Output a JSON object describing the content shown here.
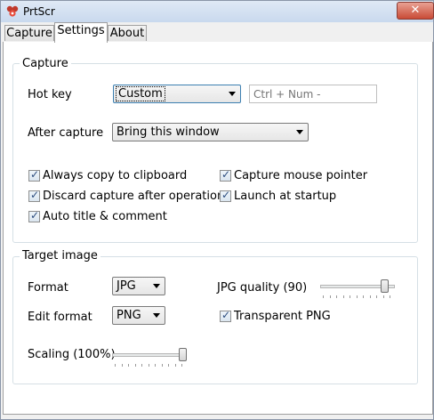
{
  "window": {
    "title": "PrtScr",
    "close_label": "✕"
  },
  "tabs": [
    {
      "label": "Capture",
      "active": false
    },
    {
      "label": "Settings",
      "active": true
    },
    {
      "label": "About",
      "active": false
    }
  ],
  "capture_group": {
    "title": "Capture",
    "hotkey_label": "Hot key",
    "hotkey_value": "Custom",
    "hotkey_field_placeholder": "Ctrl + Num -",
    "after_capture_label": "After capture",
    "after_capture_value": "Bring this window",
    "options": {
      "always_copy": {
        "label": "Always copy to clipboard",
        "checked": true
      },
      "capture_mouse": {
        "label": "Capture mouse pointer",
        "checked": true
      },
      "discard_capture": {
        "label": "Discard capture after operation",
        "checked": true
      },
      "launch_startup": {
        "label": "Launch at startup",
        "checked": true
      },
      "auto_title": {
        "label": "Auto title & comment",
        "checked": true
      }
    }
  },
  "target_group": {
    "title": "Target image",
    "format_label": "Format",
    "format_value": "JPG",
    "edit_format_label": "Edit format",
    "edit_format_value": "PNG",
    "jpg_quality_label": "JPG quality (90)",
    "jpg_quality_value": 90,
    "transparent_png": {
      "label": "Transparent PNG",
      "checked": true
    },
    "scaling_label": "Scaling (100%)",
    "scaling_value": 100
  }
}
